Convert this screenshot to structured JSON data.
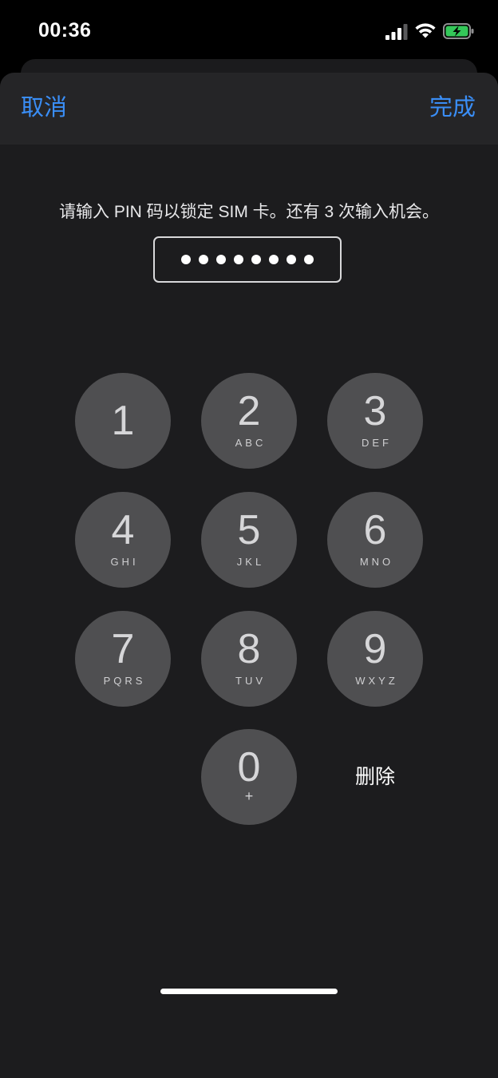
{
  "status_bar": {
    "time": "00:36",
    "icons": [
      "cellular-signal-icon",
      "wifi-icon",
      "battery-charging-icon"
    ],
    "battery_color": "#34c759"
  },
  "nav": {
    "cancel_label": "取消",
    "done_label": "完成",
    "accent_color": "#3a8ef6"
  },
  "prompt": {
    "text": "请输入 PIN 码以锁定 SIM 卡。还有 3 次输入机会。"
  },
  "pin_field": {
    "entered_digit_count": 8
  },
  "keypad": {
    "keys": [
      {
        "digit": "1",
        "letters": ""
      },
      {
        "digit": "2",
        "letters": "ABC"
      },
      {
        "digit": "3",
        "letters": "DEF"
      },
      {
        "digit": "4",
        "letters": "GHI"
      },
      {
        "digit": "5",
        "letters": "JKL"
      },
      {
        "digit": "6",
        "letters": "MNO"
      },
      {
        "digit": "7",
        "letters": "PQRS"
      },
      {
        "digit": "8",
        "letters": "TUV"
      },
      {
        "digit": "9",
        "letters": "WXYZ"
      },
      {
        "digit": "0",
        "letters": "+"
      }
    ],
    "delete_label": "删除"
  }
}
